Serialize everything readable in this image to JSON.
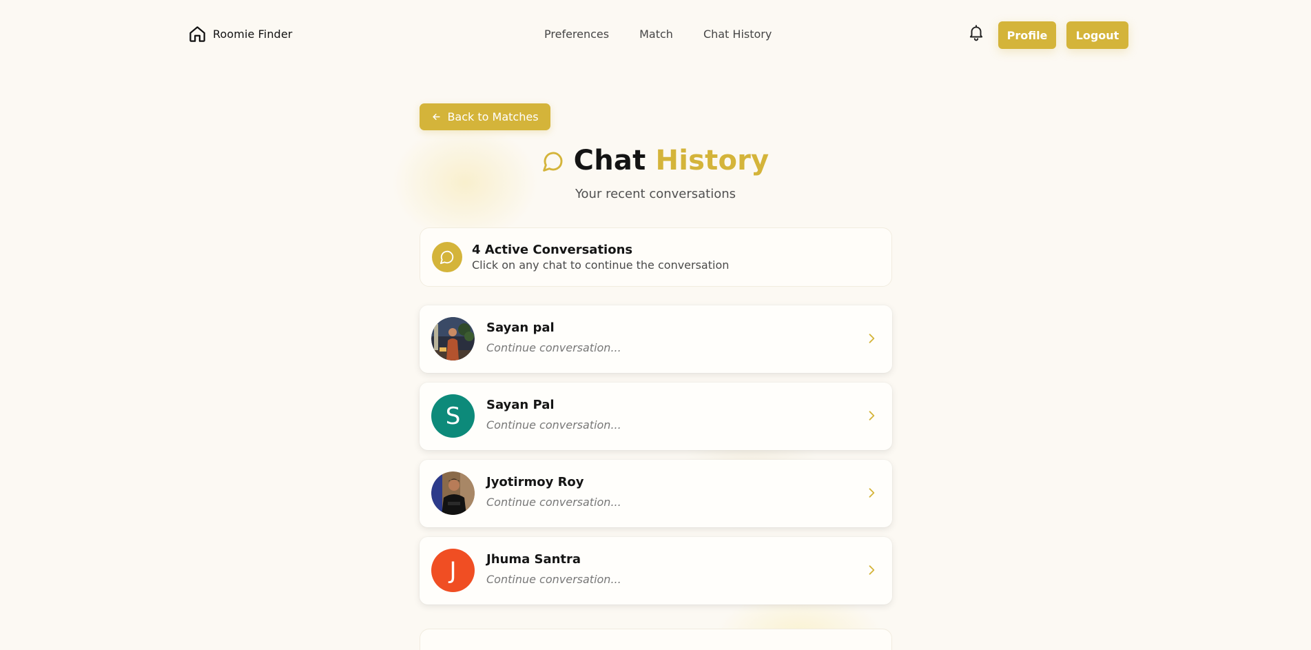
{
  "brand": {
    "name": "Roomie Finder",
    "icon": "home-icon"
  },
  "nav": {
    "links": [
      "Preferences",
      "Match",
      "Chat History"
    ]
  },
  "header_actions": {
    "profile_label": "Profile",
    "logout_label": "Logout",
    "bell_icon": "bell-icon"
  },
  "back_button": {
    "label": "Back to Matches",
    "icon": "arrow-left-icon"
  },
  "heading": {
    "part1": "Chat",
    "part2": "History",
    "subtitle": "Your recent conversations",
    "icon": "chat-bubble-icon"
  },
  "summary": {
    "title": "4 Active Conversations",
    "subtitle": "Click on any chat to continue the conversation"
  },
  "chats": [
    {
      "name": "Sayan pal",
      "preview": "Continue conversation...",
      "avatar_type": "photo"
    },
    {
      "name": "Sayan Pal",
      "preview": "Continue conversation...",
      "avatar_type": "initial",
      "initial": "S",
      "avatar_color": "#0d8a7a"
    },
    {
      "name": "Jyotirmoy Roy",
      "preview": "Continue conversation...",
      "avatar_type": "photo"
    },
    {
      "name": "Jhuma Santra",
      "preview": "Continue conversation...",
      "avatar_type": "initial",
      "initial": "J",
      "avatar_color": "#f04e23"
    }
  ],
  "colors": {
    "accent": "#d4b43a",
    "background": "#fcf9f3"
  }
}
